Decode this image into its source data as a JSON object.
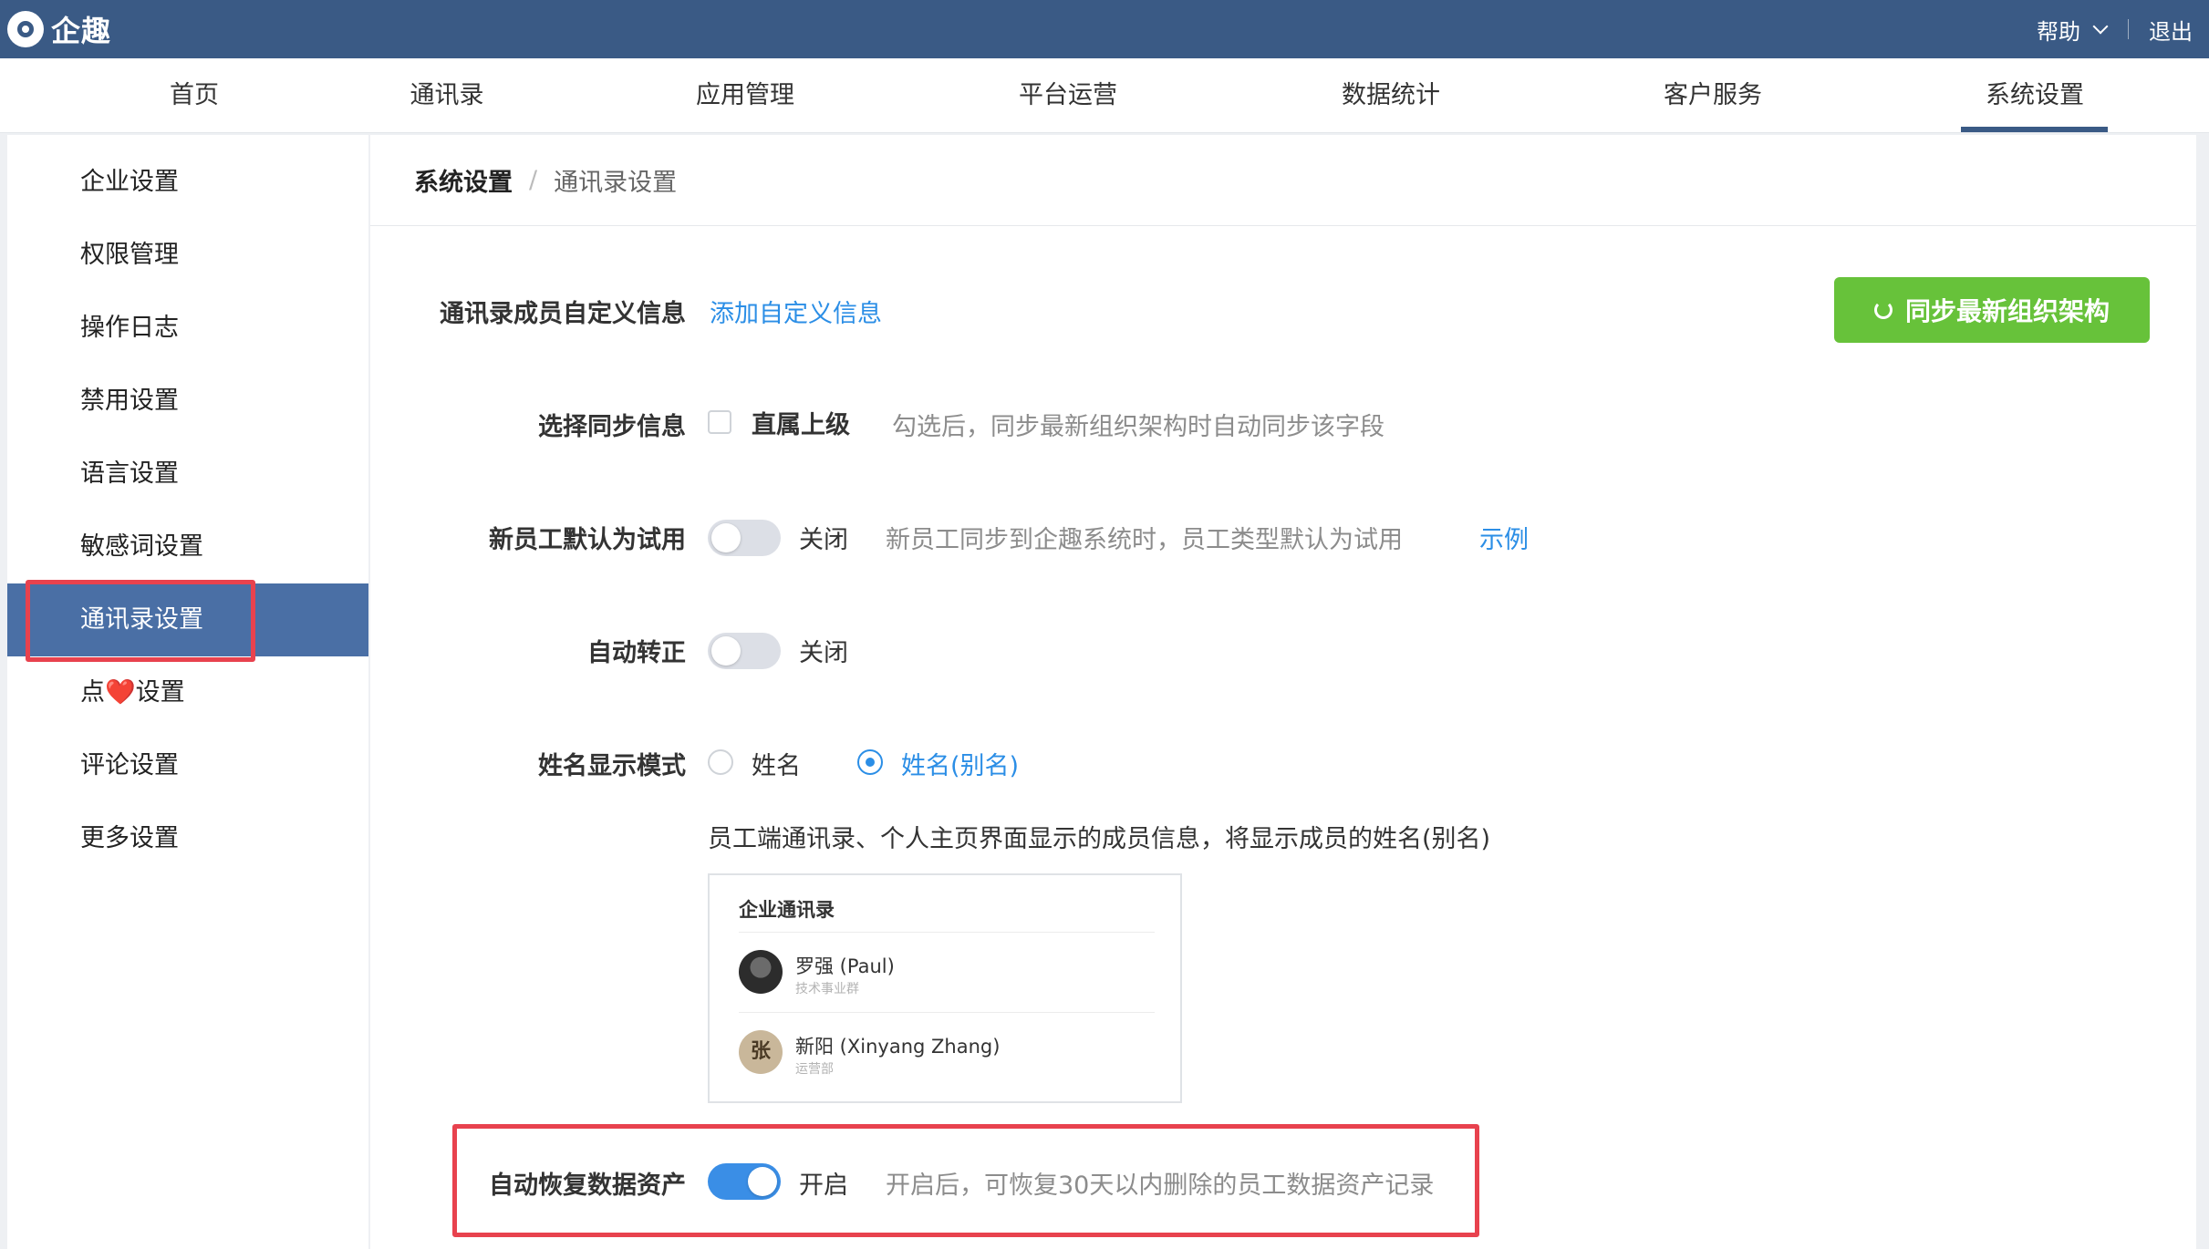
{
  "app": {
    "name": "企趣"
  },
  "top_right": {
    "help": "帮助",
    "logout": "退出"
  },
  "nav": {
    "tabs": [
      "首页",
      "通讯录",
      "应用管理",
      "平台运营",
      "数据统计",
      "客户服务",
      "系统设置"
    ],
    "active_index": 6
  },
  "sidebar": {
    "items": [
      {
        "label": "企业设置"
      },
      {
        "label": "权限管理"
      },
      {
        "label": "操作日志"
      },
      {
        "label": "禁用设置"
      },
      {
        "label": "语言设置"
      },
      {
        "label": "敏感词设置"
      },
      {
        "label": "通讯录设置",
        "active": true
      },
      {
        "label_pre": "点",
        "heart": "❤️",
        "label_post": "设置"
      },
      {
        "label": "评论设置"
      },
      {
        "label": "更多设置"
      }
    ]
  },
  "breadcrumb": {
    "root": "系统设置",
    "separator": "/",
    "current": "通讯录设置"
  },
  "custom_info": {
    "label": "通讯录成员自定义信息",
    "link": "添加自定义信息"
  },
  "sync_button": {
    "label": "同步最新组织架构"
  },
  "sync_info": {
    "label": "选择同步信息",
    "checkbox_label": "直属上级",
    "checked": false,
    "hint": "勾选后，同步最新组织架构时自动同步该字段"
  },
  "trial_default": {
    "label": "新员工默认为试用",
    "state": "关闭",
    "on": false,
    "hint": "新员工同步到企趣系统时，员工类型默认为试用",
    "example_link": "示例"
  },
  "auto_regular": {
    "label": "自动转正",
    "state": "关闭",
    "on": false
  },
  "name_mode": {
    "label": "姓名显示模式",
    "options": [
      "姓名",
      "姓名(别名)"
    ],
    "selected_index": 1,
    "description": "员工端通讯录、个人主页界面显示的成员信息，将显示成员的姓名(别名)"
  },
  "preview": {
    "title": "企业通讯录",
    "members": [
      {
        "name": "罗强 (Paul)",
        "dept": "技术事业群"
      },
      {
        "name": "新阳 (Xinyang Zhang)",
        "dept": "运营部",
        "avatar_char": "张"
      }
    ]
  },
  "auto_restore": {
    "label": "自动恢复数据资产",
    "state": "开启",
    "on": true,
    "hint": "开启后，可恢复30天以内删除的员工数据资产记录"
  },
  "colors": {
    "topbar": "#3a5a85",
    "accent_blue": "#2b8ee6",
    "sync_green": "#67c23a",
    "highlight_red": "#e8424e"
  }
}
